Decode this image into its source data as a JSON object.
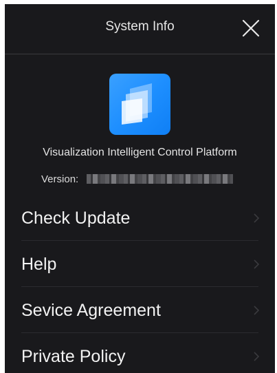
{
  "header": {
    "title": "System Info",
    "close_icon": "close-icon"
  },
  "app": {
    "logo_icon": "app-logo-icon",
    "name": "Visualization Intelligent Control Platform",
    "version_label": "Version:",
    "version_value": ""
  },
  "menu": {
    "items": [
      {
        "label": "Check Update",
        "icon": "chevron-right-icon"
      },
      {
        "label": "Help",
        "icon": "chevron-right-icon"
      },
      {
        "label": "Sevice Agreement",
        "icon": "chevron-right-icon"
      },
      {
        "label": "Private Policy",
        "icon": "chevron-right-icon"
      }
    ]
  },
  "colors": {
    "background": "#19191c",
    "accent": "#1e8fff",
    "text": "#f2f2f2"
  }
}
